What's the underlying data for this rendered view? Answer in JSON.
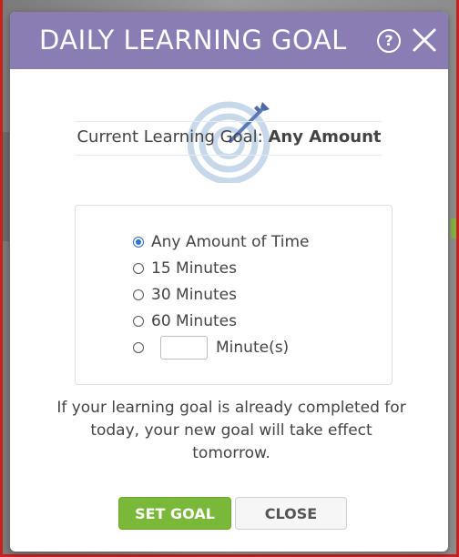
{
  "dialog": {
    "title": "DAILY LEARNING GOAL",
    "help_icon": "question-circle-icon",
    "help_glyph": "?",
    "close_icon": "close-x-icon"
  },
  "current_goal": {
    "label": "Current Learning Goal:",
    "value": "Any Amount"
  },
  "options": [
    {
      "label": "Any Amount of Time",
      "selected": true
    },
    {
      "label": "15 Minutes",
      "selected": false
    },
    {
      "label": "30 Minutes",
      "selected": false
    },
    {
      "label": "60 Minutes",
      "selected": false
    }
  ],
  "custom_option": {
    "value": "",
    "unit_label": "Minute(s)",
    "selected": false
  },
  "note": "If your learning goal is already completed for today, your new goal will take effect tomorrow.",
  "buttons": {
    "set_goal": "SET GOAL",
    "close": "CLOSE"
  },
  "colors": {
    "header": "#8a7db4",
    "set_goal": "#7ab83a",
    "radio_selected": "#2f6fd6",
    "target_graphic": "#b7cde4"
  }
}
